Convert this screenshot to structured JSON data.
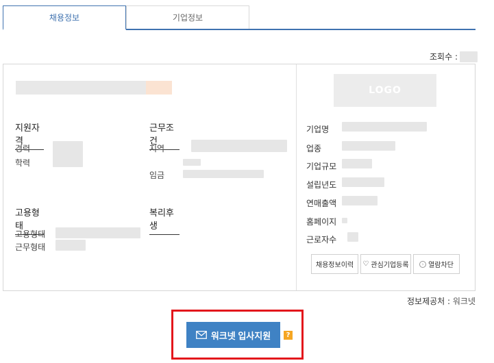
{
  "tabs": [
    {
      "label": "채용정보"
    },
    {
      "label": "기업정보"
    }
  ],
  "views": {
    "label": "조회수 :"
  },
  "sections": {
    "qualification": {
      "title": "지원자격",
      "labels": [
        "경력",
        "학력"
      ]
    },
    "conditions": {
      "title": "근무조건",
      "labels": [
        "지역",
        "임금"
      ]
    },
    "employment": {
      "title": "고용형태",
      "labels": [
        "고용형태",
        "근무형태"
      ]
    },
    "welfare": {
      "title": "복리후생"
    }
  },
  "company": {
    "logo_text": "LOGO",
    "labels": [
      "기업명",
      "업종",
      "기업규모",
      "설립년도",
      "연매출액",
      "홈페이지",
      "근로자수"
    ]
  },
  "actions": {
    "history": "채용정보이력",
    "favorite": "관심기업등록",
    "block": "열람차단"
  },
  "source": {
    "label": "정보제공처 :",
    "value": "워크넷"
  },
  "apply": {
    "label": "워크넷 입사지원",
    "help": "?"
  },
  "colors": {
    "accent": "#3f72af",
    "button": "#3f82c4",
    "highlight": "#e3161b",
    "help": "#f5a623"
  }
}
